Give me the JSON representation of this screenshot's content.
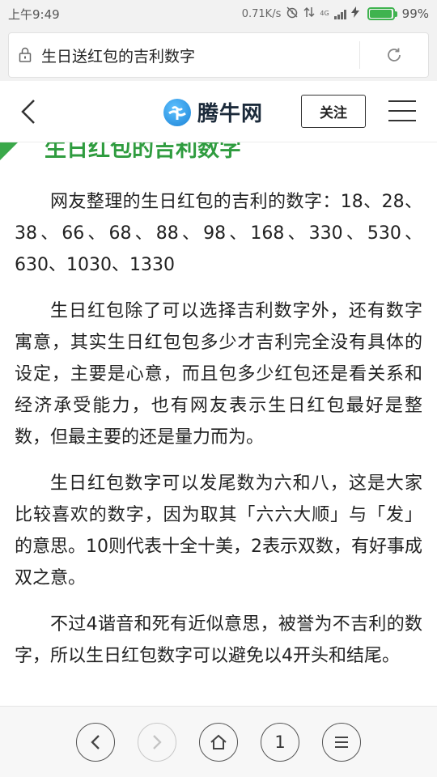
{
  "status_bar": {
    "time": "上午9:49",
    "network_speed": "0.71K/s",
    "network_type": "4G",
    "battery_percent": "99%",
    "battery_level": 0.99
  },
  "browser": {
    "page_title": "生日送红包的吉利数字"
  },
  "site": {
    "name": "腾牛网",
    "follow_label": "关注"
  },
  "article": {
    "heading": "生日红包的吉利数字",
    "paragraphs": [
      "网友整理的生日红包的吉利的数字：18、28、38、66、68、88、98、168、330、530、630、1030、1330",
      "生日红包除了可以选择吉利数字外，还有数字寓意，其实生日红包包多少才吉利完全没有具体的设定，主要是心意，而且包多少红包还是看关系和经济承受能力，也有网友表示生日红包最好是整数，但最主要的还是量力而为。",
      "生日红包数字可以发尾数为六和八，这是大家比较喜欢的数字，因为取其「六六大顺」与「发」的意思。10则代表十全十美，2表示双数，有好事成双之意。",
      "不过4谐音和死有近似意思，被誉为不吉利的数字，所以生日红包数字可以避免以4开头和结尾。"
    ]
  },
  "bottom_nav": {
    "tab_count": "1"
  },
  "colors": {
    "accent_green": "#2f9c3f",
    "battery_green": "#3fb34f",
    "logo_blue": "#1b83d6"
  }
}
